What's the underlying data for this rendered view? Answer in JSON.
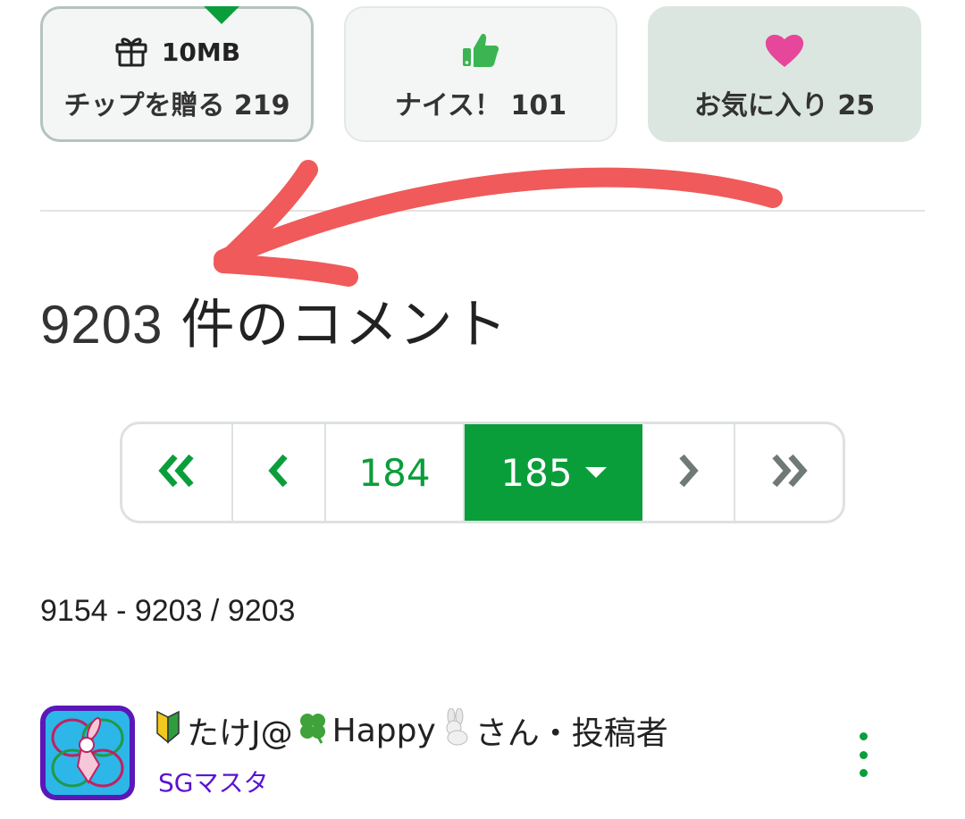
{
  "actions": {
    "tip": {
      "size": "10MB",
      "label": "チップを贈る 219",
      "icon": "gift-icon"
    },
    "nice": {
      "label": "ナイス！ 101",
      "icon": "thumbs-up-icon"
    },
    "favorite": {
      "label": "お気に入り 25",
      "icon": "heart-icon"
    }
  },
  "comments": {
    "count": "9203",
    "title_suffix": " 件のコメント",
    "range": "9154 - 9203 / 9203"
  },
  "pager": {
    "prev_page": "184",
    "current_page": "185",
    "icons": [
      "double-chevron-left-icon",
      "chevron-left-icon",
      "chevron-right-icon",
      "double-chevron-right-icon"
    ]
  },
  "comment": {
    "name": "たけJ@",
    "name_mid": "Happy",
    "name_suffix": "さん・投稿者",
    "role": "SGマスタ"
  },
  "colors": {
    "accent": "#0a9e3b",
    "heart": "#e6479a",
    "annotation": "#f05a5a",
    "role": "#5a14d0"
  }
}
